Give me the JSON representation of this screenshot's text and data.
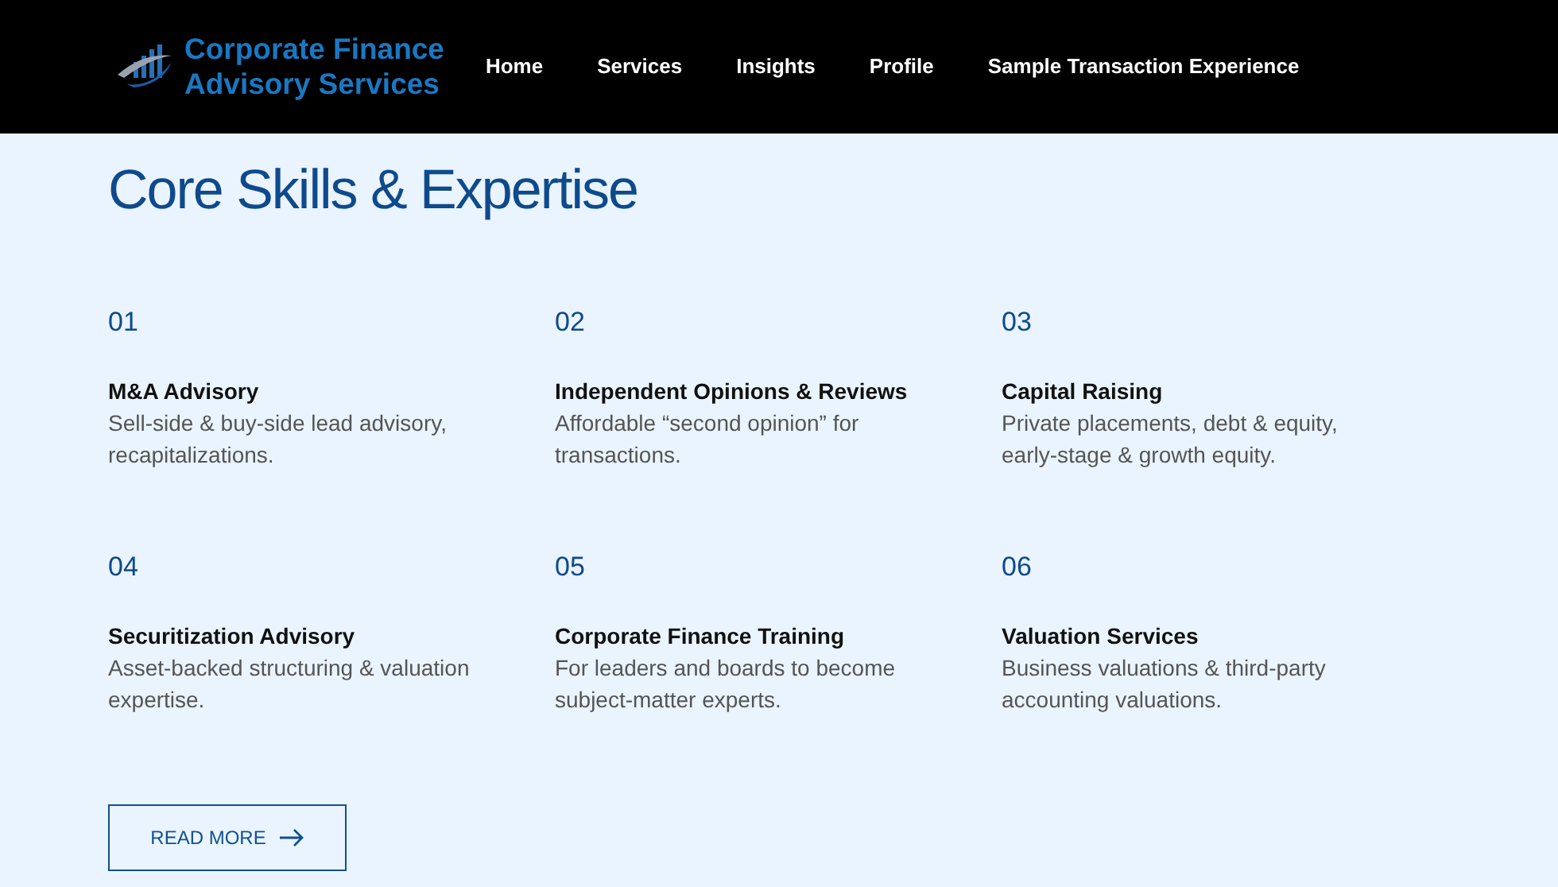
{
  "brand": {
    "line_1": "Corporate Finance",
    "line_2": "Advisory Services"
  },
  "nav": [
    {
      "label": "Home"
    },
    {
      "label": "Services"
    },
    {
      "label": "Insights"
    },
    {
      "label": "Profile"
    },
    {
      "label": "Sample Transaction Experience"
    }
  ],
  "heading": "Core Skills & Expertise",
  "skills": [
    {
      "number": "01",
      "title": "M&A Advisory",
      "description": "Sell-side & buy-side lead advisory, recapitalizations."
    },
    {
      "number": "02",
      "title": "Independent Opinions & Reviews",
      "description": "Affordable “second opinion” for transactions."
    },
    {
      "number": "03",
      "title": "Capital Raising",
      "description": "Private placements, debt & equity, early-stage & growth equity."
    },
    {
      "number": "04",
      "title": "Securitization Advisory",
      "description": "Asset-backed structuring & valuation expertise."
    },
    {
      "number": "05",
      "title": "Corporate Finance Training",
      "description": "For leaders and boards to become subject-matter experts."
    },
    {
      "number": "06",
      "title": "Valuation Services",
      "description": "Business valuations & third-party accounting valuations."
    }
  ],
  "read_more": "READ MORE"
}
